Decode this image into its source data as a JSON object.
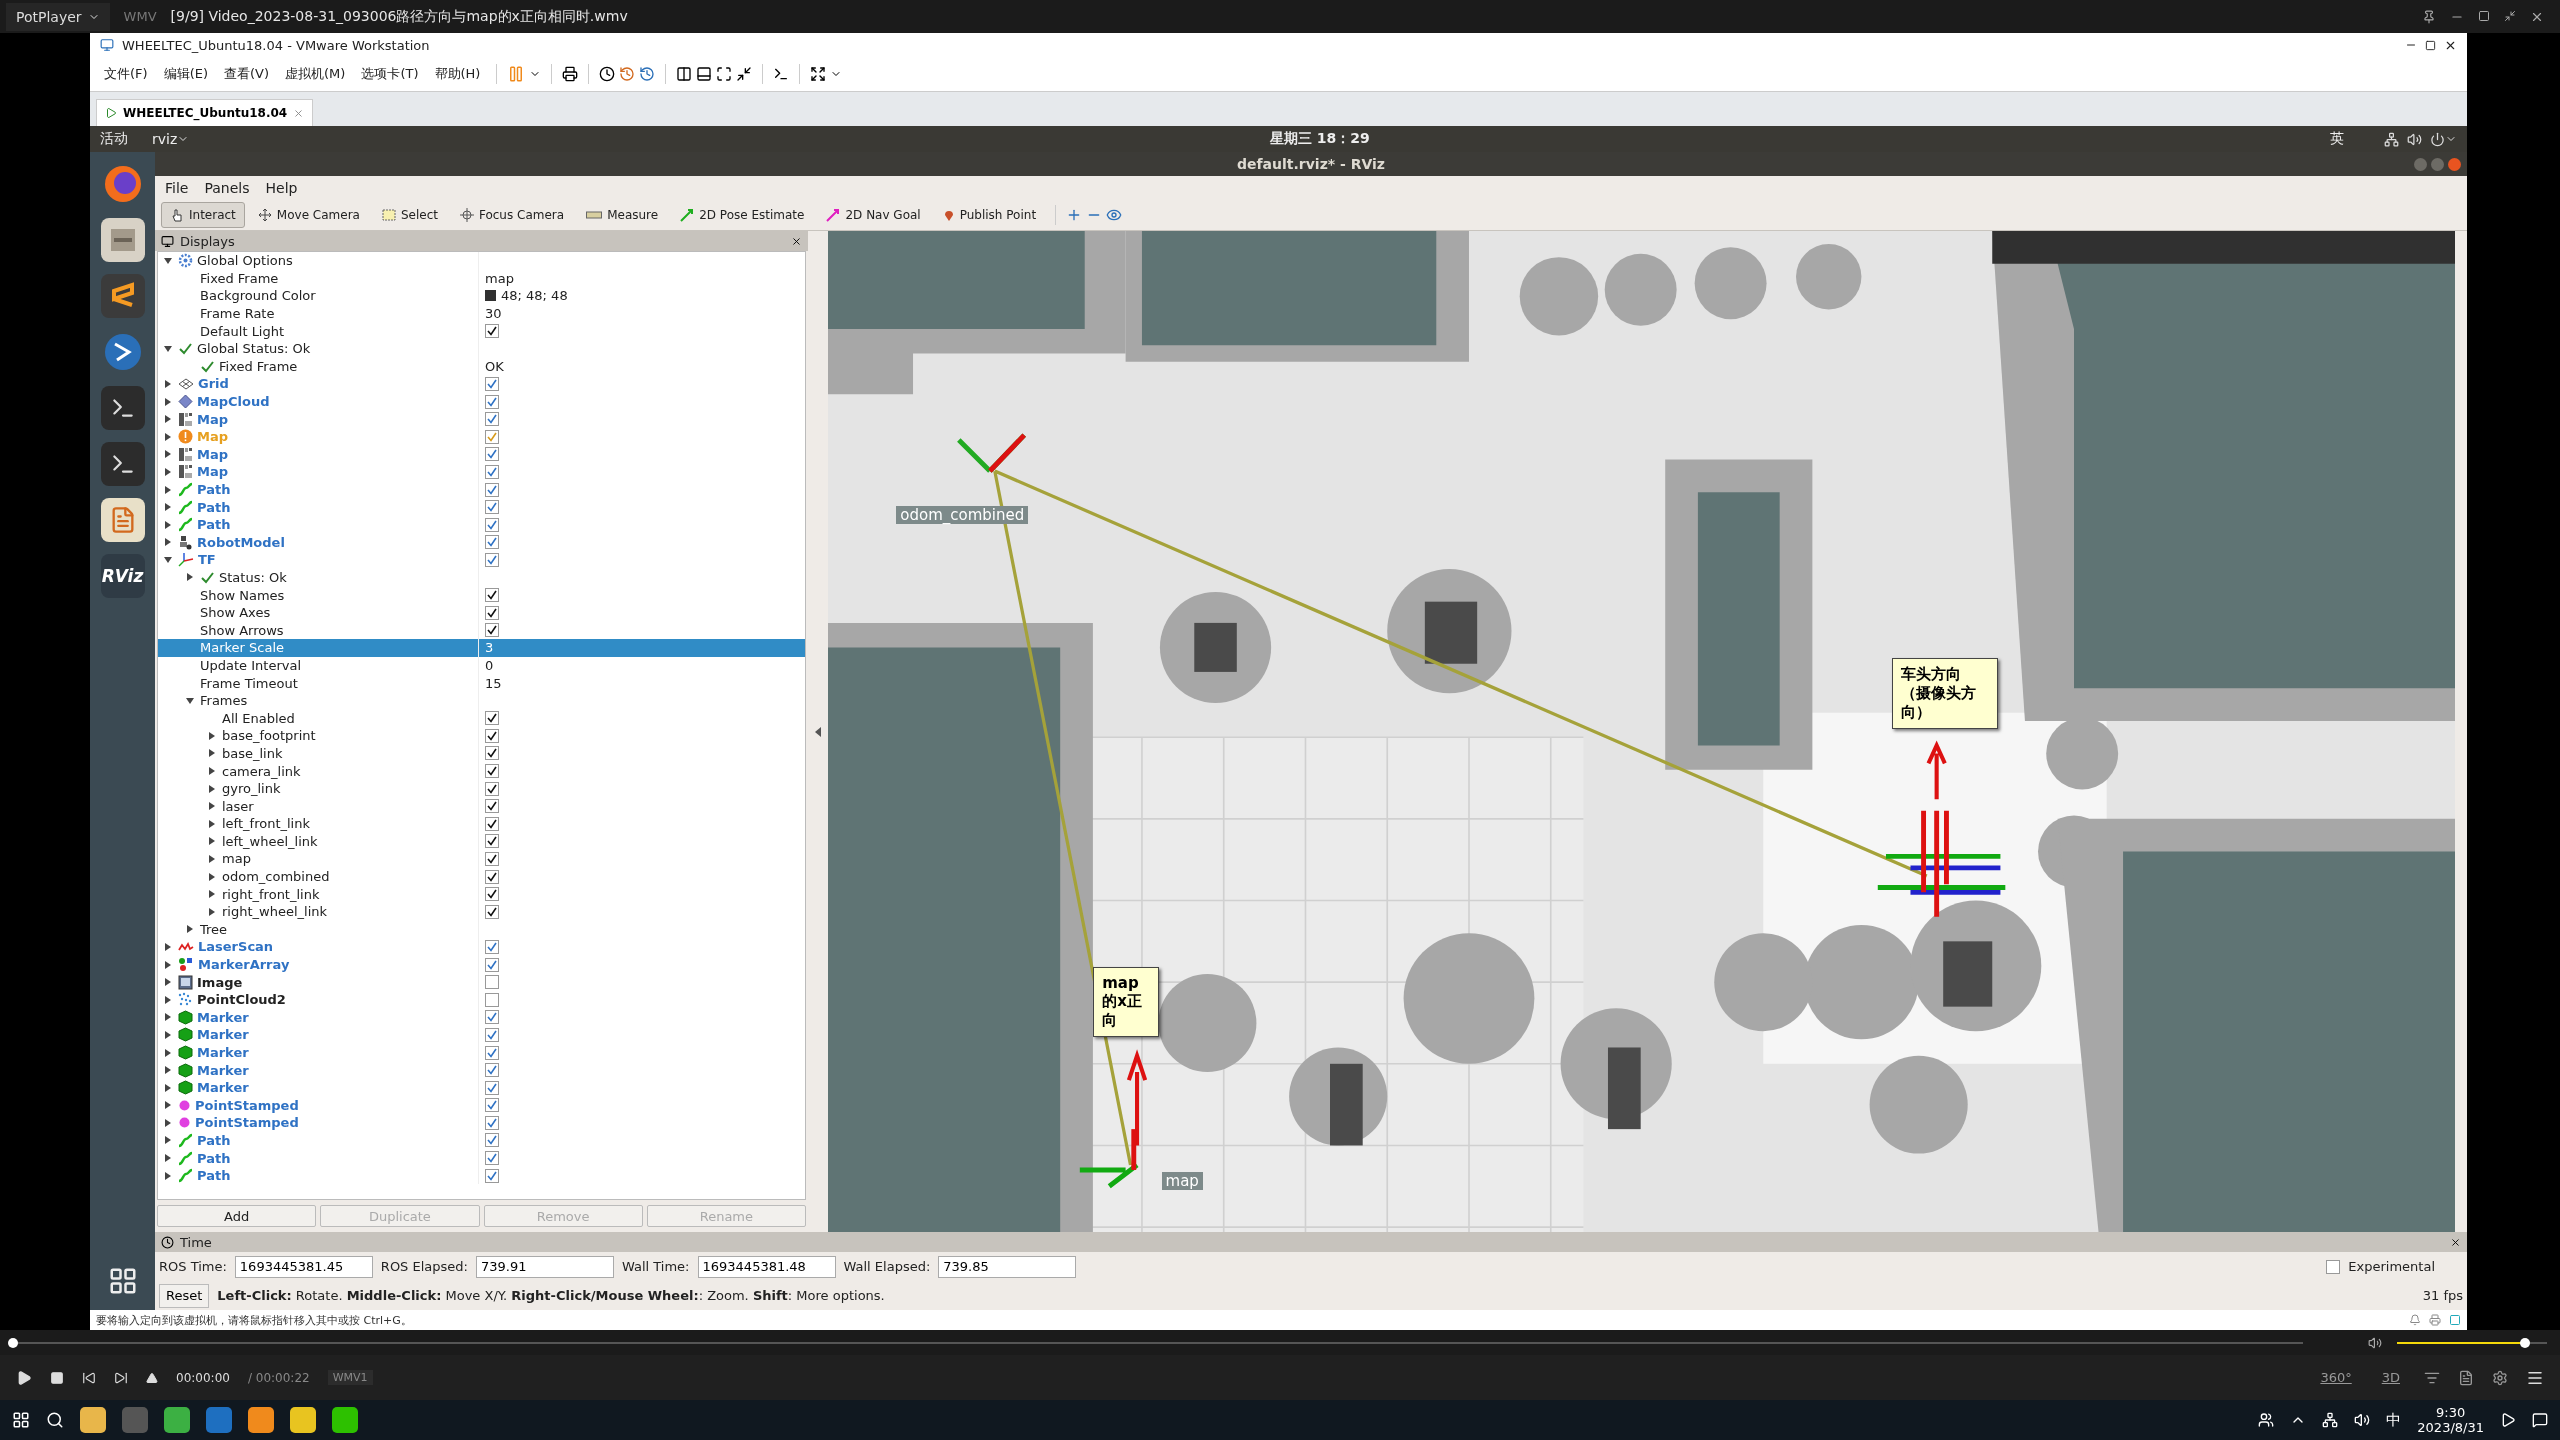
{
  "player": {
    "app": "PotPlayer",
    "format": "WMV",
    "title": "[9/9] Video_2023-08-31_093006路径方向与map的x正向相同时.wmv",
    "time": "00:00:00",
    "duration": "/ 00:00:22",
    "codec": "WMV1",
    "seek": {
      "level": 0
    },
    "volume": {
      "level": 0.85
    },
    "tools": [
      "360°",
      "3D"
    ]
  },
  "vmware": {
    "title": "WHEELTEC_Ubuntu18.04 - VMware Workstation",
    "menus": [
      "文件(F)",
      "编辑(E)",
      "查看(V)",
      "虚拟机(M)",
      "选项卡(T)",
      "帮助(H)"
    ],
    "tab": "WHEELTEC_Ubuntu18.04",
    "status": "要将输入定向到该虚拟机，请将鼠标指针移入其中或按 Ctrl+G。"
  },
  "ubuntu": {
    "activities": "活动",
    "app": "rviz",
    "clock": "星期三 18：29",
    "input": "英",
    "dock": [
      {
        "kind": "browser"
      },
      {
        "kind": "files"
      },
      {
        "kind": "editor"
      },
      {
        "kind": "blue"
      },
      {
        "kind": "terminal"
      },
      {
        "kind": "terminal"
      },
      {
        "kind": "notes"
      },
      {
        "kind": "rviz",
        "label": "RViz"
      }
    ]
  },
  "rviz": {
    "title": "default.rviz* - RViz",
    "menus": [
      "File",
      "Panels",
      "Help"
    ],
    "tools": [
      {
        "label": "Interact",
        "kind": "interact",
        "selected": true
      },
      {
        "label": "Move Camera",
        "kind": "move",
        "selected": false
      },
      {
        "label": "Select",
        "kind": "select",
        "selected": false
      },
      {
        "label": "Focus Camera",
        "kind": "focus",
        "selected": false
      },
      {
        "label": "Measure",
        "kind": "measure",
        "selected": false
      },
      {
        "label": "2D Pose Estimate",
        "kind": "pose",
        "selected": false
      },
      {
        "label": "2D Nav Goal",
        "kind": "goal",
        "selected": false
      },
      {
        "label": "Publish Point",
        "kind": "point",
        "selected": false
      }
    ],
    "displays": {
      "title": "Displays",
      "items": [
        {
          "label": "Global Options",
          "kind": "options",
          "expanded": true,
          "selected": false,
          "children": [
            {
              "label": "Fixed Frame",
              "value": "map",
              "selected": false
            },
            {
              "label": "Background Color",
              "value": "48; 48; 48",
              "color": "#303030",
              "selected": false
            },
            {
              "label": "Frame Rate",
              "value": "30",
              "selected": false
            },
            {
              "label": "Default Light",
              "checked": true,
              "selected": false
            }
          ]
        },
        {
          "label": "Global Status: Ok",
          "kind": "status",
          "expanded": true,
          "selected": false,
          "children": [
            {
              "label": "Fixed Frame",
              "kind": "status",
              "value": "OK",
              "selected": false
            }
          ]
        },
        {
          "label": "Grid",
          "kind": "grid",
          "expanded": false,
          "checked": true,
          "warning": false,
          "selected": false
        },
        {
          "label": "MapCloud",
          "kind": "mapcloud",
          "expanded": false,
          "checked": true,
          "warning": false,
          "selected": false
        },
        {
          "label": "Map",
          "kind": "map",
          "expanded": false,
          "checked": true,
          "warning": false,
          "selected": false
        },
        {
          "label": "Map",
          "kind": "map",
          "expanded": false,
          "checked": true,
          "warning": true,
          "selected": false
        },
        {
          "label": "Map",
          "kind": "map",
          "expanded": false,
          "checked": true,
          "warning": false,
          "selected": false
        },
        {
          "label": "Map",
          "kind": "map",
          "expanded": false,
          "checked": true,
          "warning": false,
          "selected": false
        },
        {
          "label": "Path",
          "kind": "path",
          "expanded": false,
          "checked": true,
          "warning": false,
          "selected": false
        },
        {
          "label": "Path",
          "kind": "path",
          "expanded": false,
          "checked": true,
          "warning": false,
          "selected": false
        },
        {
          "label": "Path",
          "kind": "path",
          "expanded": false,
          "checked": true,
          "warning": false,
          "selected": false
        },
        {
          "label": "RobotModel",
          "kind": "robot",
          "expanded": false,
          "checked": true,
          "warning": false,
          "selected": false
        },
        {
          "label": "TF",
          "kind": "tf",
          "expanded": true,
          "checked": true,
          "warning": false,
          "selected": false,
          "children": [
            {
              "label": "Status: Ok",
              "kind": "status",
              "expanded": false,
              "selected": false
            },
            {
              "label": "Show Names",
              "checked": true,
              "selected": false
            },
            {
              "label": "Show Axes",
              "checked": true,
              "selected": false
            },
            {
              "label": "Show Arrows",
              "checked": true,
              "selected": false
            },
            {
              "label": "Marker Scale",
              "value": "3",
              "selected": true
            },
            {
              "label": "Update Interval",
              "value": "0",
              "selected": false
            },
            {
              "label": "Frame Timeout",
              "value": "15",
              "selected": false
            },
            {
              "label": "Frames",
              "expanded": true,
              "selected": false,
              "children": [
                {
                  "label": "All Enabled",
                  "checked": true,
                  "selected": false
                },
                {
                  "label": "base_footprint",
                  "expanded": false,
                  "checked": true,
                  "selected": false
                },
                {
                  "label": "base_link",
                  "expanded": false,
                  "checked": true,
                  "selected": false
                },
                {
                  "label": "camera_link",
                  "expanded": false,
                  "checked": true,
                  "selected": false
                },
                {
                  "label": "gyro_link",
                  "expanded": false,
                  "checked": true,
                  "selected": false
                },
                {
                  "label": "laser",
                  "expanded": false,
                  "checked": true,
                  "selected": false
                },
                {
                  "label": "left_front_link",
                  "expanded": false,
                  "checked": true,
                  "selected": false
                },
                {
                  "label": "left_wheel_link",
                  "expanded": false,
                  "checked": true,
                  "selected": false
                },
                {
                  "label": "map",
                  "expanded": false,
                  "checked": true,
                  "selected": false
                },
                {
                  "label": "odom_combined",
                  "expanded": false,
                  "checked": true,
                  "selected": false
                },
                {
                  "label": "right_front_link",
                  "expanded": false,
                  "checked": true,
                  "selected": false
                },
                {
                  "label": "right_wheel_link",
                  "expanded": false,
                  "checked": true,
                  "selected": false
                }
              ]
            },
            {
              "label": "Tree",
              "expanded": false,
              "selected": false
            }
          ]
        },
        {
          "label": "LaserScan",
          "kind": "laser",
          "expanded": false,
          "checked": true,
          "warning": false,
          "selected": false
        },
        {
          "label": "MarkerArray",
          "kind": "markerarray",
          "expanded": false,
          "checked": true,
          "warning": false,
          "selected": false
        },
        {
          "label": "Image",
          "kind": "image",
          "expanded": false,
          "checked": false,
          "warning": false,
          "selected": false
        },
        {
          "label": "PointCloud2",
          "kind": "pointcloud",
          "expanded": false,
          "checked": false,
          "warning": false,
          "selected": false
        },
        {
          "label": "Marker",
          "kind": "marker",
          "expanded": false,
          "checked": true,
          "warning": false,
          "selected": false
        },
        {
          "label": "Marker",
          "kind": "marker",
          "expanded": false,
          "checked": true,
          "warning": false,
          "selected": false
        },
        {
          "label": "Marker",
          "kind": "marker",
          "expanded": false,
          "checked": true,
          "warning": false,
          "selected": false
        },
        {
          "label": "Marker",
          "kind": "marker",
          "expanded": false,
          "checked": true,
          "warning": false,
          "selected": false
        },
        {
          "label": "Marker",
          "kind": "marker",
          "expanded": false,
          "checked": true,
          "warning": false,
          "selected": false
        },
        {
          "label": "PointStamped",
          "kind": "point",
          "expanded": false,
          "checked": true,
          "warning": false,
          "selected": false
        },
        {
          "label": "PointStamped",
          "kind": "point",
          "expanded": false,
          "checked": true,
          "warning": false,
          "selected": false
        },
        {
          "label": "Path",
          "kind": "path",
          "expanded": false,
          "checked": true,
          "warning": false,
          "selected": false
        },
        {
          "label": "Path",
          "kind": "path",
          "expanded": false,
          "checked": true,
          "warning": false,
          "selected": false
        },
        {
          "label": "Path",
          "kind": "path",
          "expanded": false,
          "checked": true,
          "warning": false,
          "selected": false
        }
      ],
      "buttons": [
        {
          "label": "Add",
          "disabled": false
        },
        {
          "label": "Duplicate",
          "disabled": true
        },
        {
          "label": "Remove",
          "disabled": true
        },
        {
          "label": "Rename",
          "disabled": true
        }
      ]
    },
    "view": {
      "frame_labels": [
        "odom_combined",
        "map"
      ],
      "callouts": [
        "车头方向（摄像头方向）",
        "map的x正向"
      ]
    },
    "time": {
      "title": "Time",
      "fields": [
        {
          "label": "ROS Time:",
          "value": "1693445381.45"
        },
        {
          "label": "ROS Elapsed:",
          "value": "739.91"
        },
        {
          "label": "Wall Time:",
          "value": "1693445381.48"
        },
        {
          "label": "Wall Elapsed:",
          "value": "739.85"
        }
      ],
      "reset": "Reset",
      "help": "**Left-Click:** Rotate. **Middle-Click:** Move X/Y. **Right-Click/Mouse Wheel:**: Zoom. **Shift**: More options.",
      "experimental": {
        "label": "Experimental",
        "checked": false
      },
      "fps": "31 fps"
    }
  },
  "taskbar": {
    "input": "中",
    "time": "9:30",
    "date": "2023/8/31"
  }
}
